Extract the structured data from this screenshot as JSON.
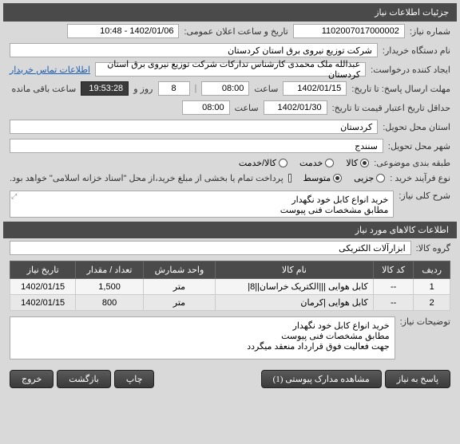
{
  "header": {
    "title": "جزئیات اطلاعات نیاز"
  },
  "fields": {
    "request_no_label": "شماره نیاز:",
    "request_no": "1102007017000002",
    "announce_label": "تاریخ و ساعت اعلان عمومی:",
    "announce_value": "1402/01/06 - 10:48",
    "buyer_label": "نام دستگاه خریدار:",
    "buyer_value": "شرکت توزیع نیروی برق استان کردستان",
    "creator_label": "ایجاد کننده درخواست:",
    "creator_value": "عبدالله ملک محمدی کارشناس تدارکات شرکت توزیع نیروی برق استان کردستان",
    "contact_link": "اطلاعات تماس خریدار",
    "reply_deadline_label": "مهلت ارسال پاسخ: تا تاریخ:",
    "reply_date": "1402/01/15",
    "reply_hour": "08:00",
    "reply_days": "8",
    "reply_remaining": "19:53:28",
    "hour_label": "ساعت",
    "day_and_label": "روز و",
    "remaining_label": "ساعت باقی مانده",
    "validity_label": "حداقل تاریخ اعتبار قیمت تا تاریخ:",
    "validity_date": "1402/01/30",
    "validity_hour": "08:00",
    "province_label": "استان محل تحویل:",
    "province_value": "کردستان",
    "city_label": "شهر محل تحویل:",
    "city_value": "سنندج",
    "subject_class_label": "طبقه بندی موضوعی:",
    "purchase_process_label": "نوع فرآیند خرید :",
    "payment_note": "پرداخت تمام یا بخشی از مبلغ خرید،از محل \"اسناد خزانه اسلامی\" خواهد بود.",
    "desc_label": "شرح کلی نیاز:",
    "desc_value": "خرید انواع کابل خود نگهدار\nمطابق مشخصات فنی پیوست",
    "notes_label": "توضیحات نیاز:",
    "notes_value": "خرید انواع کابل خود نگهدار\nمطابق مشخصات فنی پیوست\nجهت فعالیت فوق قرارداد منعقد میگردد"
  },
  "radios": {
    "subject": {
      "options": [
        {
          "label": "کالا",
          "checked": true
        },
        {
          "label": "خدمت",
          "checked": false
        },
        {
          "label": "کالا/خدمت",
          "checked": false
        }
      ]
    },
    "process": {
      "options": [
        {
          "label": "جزیی",
          "checked": false
        },
        {
          "label": "متوسط",
          "checked": true
        }
      ]
    }
  },
  "items_section": {
    "title": "اطلاعات کالاهای مورد نیاز",
    "group_label": "گروه کالا:",
    "group_value": "ابزارآلات الکتریکی"
  },
  "table": {
    "headers": [
      "ردیف",
      "کد کالا",
      "نام کالا",
      "واحد شمارش",
      "تعداد / مقدار",
      "تاریخ نیاز"
    ],
    "rows": [
      {
        "idx": "1",
        "code": "--",
        "name": "کابل هوایی |||الکتریک خراسان||8|",
        "unit": "متر",
        "qty": "1,500",
        "date": "1402/01/15"
      },
      {
        "idx": "2",
        "code": "--",
        "name": "کابل هوایی |کرمان",
        "unit": "متر",
        "qty": "800",
        "date": "1402/01/15"
      }
    ]
  },
  "footer": {
    "respond": "پاسخ به نیاز",
    "attachments": "مشاهده مدارک پیوستی (1)",
    "print": "چاپ",
    "back": "بازگشت",
    "exit": "خروج"
  }
}
